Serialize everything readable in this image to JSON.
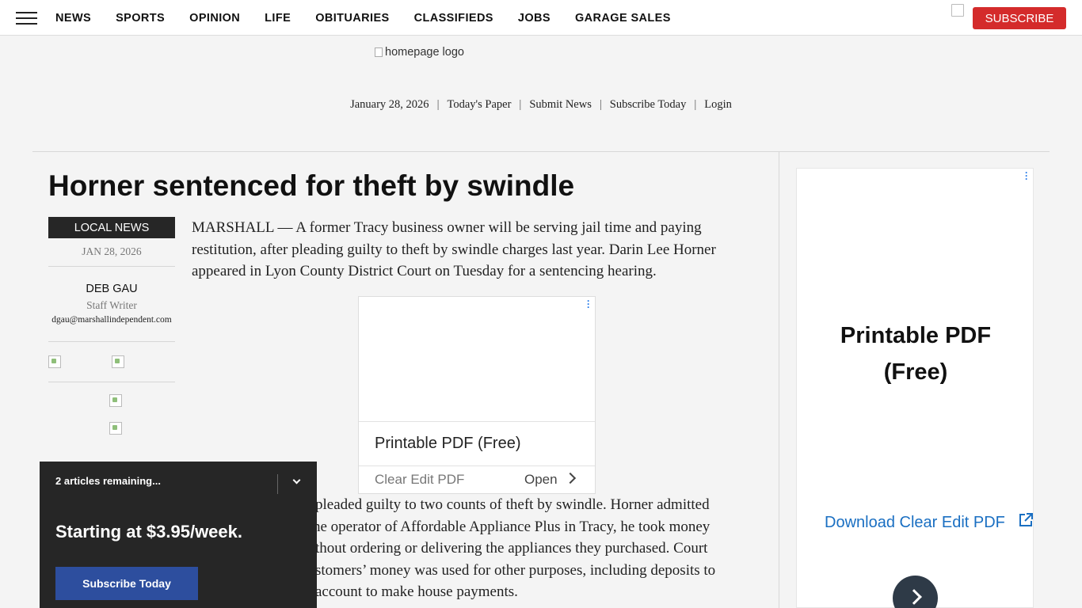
{
  "nav": {
    "links": [
      "NEWS",
      "SPORTS",
      "OPINION",
      "LIFE",
      "OBITUARIES",
      "CLASSIFIEDS",
      "JOBS",
      "GARAGE SALES"
    ],
    "subscribe_label": "SUBSCRIBE"
  },
  "masthead": {
    "logo_alt": "homepage logo",
    "date": "January 28, 2026",
    "links": [
      "Today's Paper",
      "Submit News",
      "Subscribe Today",
      "Login"
    ],
    "separator": "|"
  },
  "article": {
    "headline": "Horner sentenced for theft by swindle",
    "section": "LOCAL NEWS",
    "date": "JAN 28, 2026",
    "author": "DEB GAU",
    "author_role": "Staff Writer",
    "author_email": "dgau@marshallindependent.com",
    "paragraph_1": "MARSHALL — A former Tracy business owner will be serving jail time and paying restitution, after pleading guilty to theft by swindle charges last year. Darin Lee Horner appeared in Lyon County District Court on Tuesday for a sentencing hearing.",
    "paragraph_2_lines": [
      "pleaded guilty to two counts of theft by swindle. Horner admitted",
      "he operator of Affordable Appliance Plus in Tracy, he took money",
      "thout ordering or delivering the appliances they purchased. Court",
      "stomers’ money was used for other purposes, including deposits to",
      "account to make house payments."
    ]
  },
  "inline_ad": {
    "title": "Printable PDF (Free)",
    "sub": "Clear Edit PDF",
    "open_label": "Open"
  },
  "side_ad": {
    "title_line1": "Printable PDF",
    "title_line2": "(Free)",
    "link": "Download Clear Edit PDF"
  },
  "paywall": {
    "remaining": "2 articles remaining...",
    "price": "Starting at $3.95/week.",
    "button": "Subscribe Today"
  },
  "colors": {
    "subscribe_red": "#d42b2b",
    "paywall_bg": "#262626",
    "paywall_button": "#2d4e9e",
    "ad_link_blue": "#1a6fc2"
  }
}
